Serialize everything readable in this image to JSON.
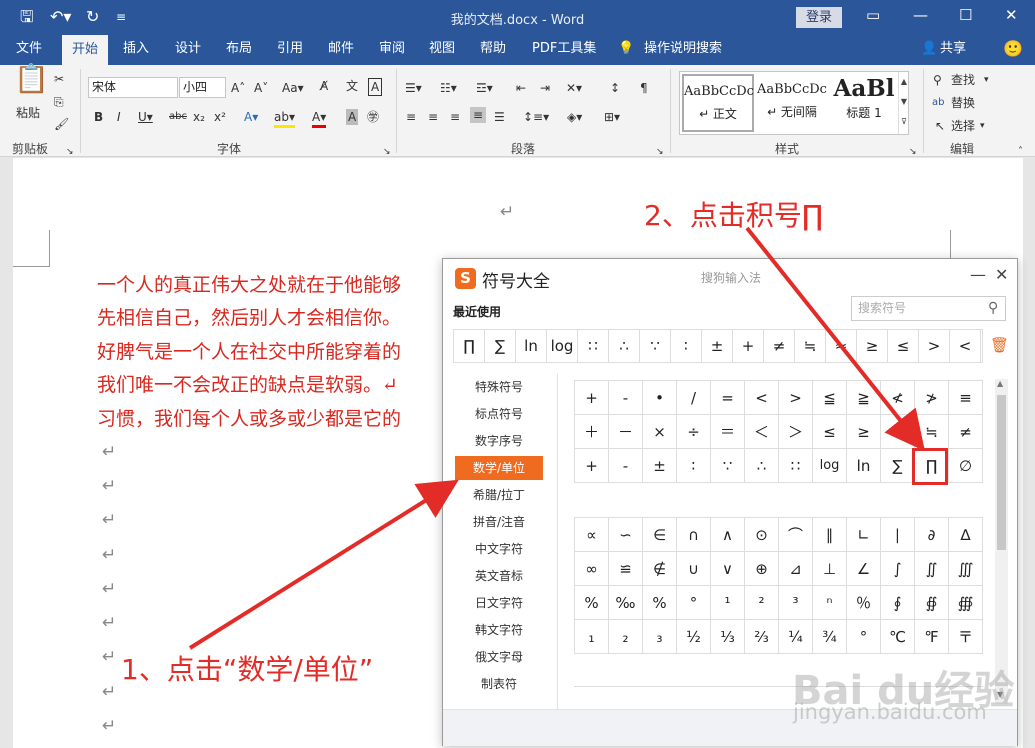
{
  "window": {
    "title": "我的文档.docx  -  Word",
    "login": "登录"
  },
  "tabs": [
    "文件",
    "开始",
    "插入",
    "设计",
    "布局",
    "引用",
    "邮件",
    "审阅",
    "视图",
    "帮助",
    "PDF工具集",
    "操作说明搜索"
  ],
  "share": "共享",
  "ribbon": {
    "clipboard": {
      "paste": "粘贴",
      "group": "剪贴板"
    },
    "font": {
      "name": "宋体",
      "size": "小四",
      "group": "字体"
    },
    "paragraph": {
      "group": "段落"
    },
    "styles": {
      "items": [
        {
          "preview": "AaBbCcDc",
          "name": "↵ 正文"
        },
        {
          "preview": "AaBbCcDc",
          "name": "↵ 无间隔"
        },
        {
          "preview": "AaBl",
          "name": "标题 1"
        }
      ],
      "group": "样式"
    },
    "editing": {
      "find": "查找",
      "replace": "替换",
      "select": "选择",
      "group": "编辑"
    }
  },
  "document": {
    "lines": [
      "一个人的真正伟大之处就在于他能够",
      "先相信自己，然后别人才会相信你。",
      "好脾气是一个人在社交中所能穿着的",
      "我们唯一不会改正的缺点是软弱。↵",
      "习惯，我们每个人或多或少都是它的"
    ]
  },
  "symbol_panel": {
    "title": "符号大全",
    "subtitle": "搜狗输入法",
    "recent_label": "最近使用",
    "search_placeholder": "搜索符号",
    "recent": [
      "∏",
      "∑",
      "ln",
      "log",
      "∷",
      "∴",
      "∵",
      "∶",
      "±",
      "+",
      "≠",
      "≒",
      "≈",
      "≥",
      "≤",
      ">",
      "<"
    ],
    "categories": [
      "特殊符号",
      "标点符号",
      "数字序号",
      "数学/单位",
      "希腊/拉丁",
      "拼音/注音",
      "中文字符",
      "英文音标",
      "日文字符",
      "韩文字符",
      "俄文字母",
      "制表符"
    ],
    "active_category": "数学/单位",
    "grid_top": [
      [
        "+",
        "-",
        "•",
        "/",
        "=",
        "<",
        ">",
        "≦",
        "≧",
        "≮",
        "≯",
        "≡"
      ],
      [
        "＋",
        "－",
        "×",
        "÷",
        "＝",
        "＜",
        "＞",
        "≤",
        "≥",
        "≈",
        "≒",
        "≠"
      ],
      [
        "+",
        "-",
        "±",
        "∶",
        "∵",
        "∴",
        "∷",
        "log",
        "ln",
        "∑",
        "∏",
        "∅"
      ]
    ],
    "grid_bottom": [
      [
        "∝",
        "∽",
        "∈",
        "∩",
        "∧",
        "⊙",
        "⌒",
        "∥",
        "∟",
        "∣",
        "∂",
        "∆"
      ],
      [
        "∞",
        "≌",
        "∉",
        "∪",
        "∨",
        "⊕",
        "⊿",
        "⊥",
        "∠",
        "∫",
        "∬",
        "∭"
      ],
      [
        "%",
        "‰",
        "%",
        "°",
        "¹",
        "²",
        "³",
        "ⁿ",
        "％",
        "∮",
        "∯",
        "∰"
      ],
      [
        "₁",
        "₂",
        "₃",
        "½",
        "⅓",
        "⅔",
        "¼",
        "¾",
        "°",
        "℃",
        "℉",
        "〒"
      ]
    ]
  },
  "annotations": {
    "step1": "1、点击“数学/单位”",
    "step2": "2、点击积号∏"
  },
  "watermark": {
    "brand": "Bai du经验",
    "url": "jingyan.baidu.com"
  },
  "colors": {
    "word_blue": "#2b579a",
    "sogou_orange": "#ef6b1f",
    "annotation_red": "#e32b27"
  }
}
